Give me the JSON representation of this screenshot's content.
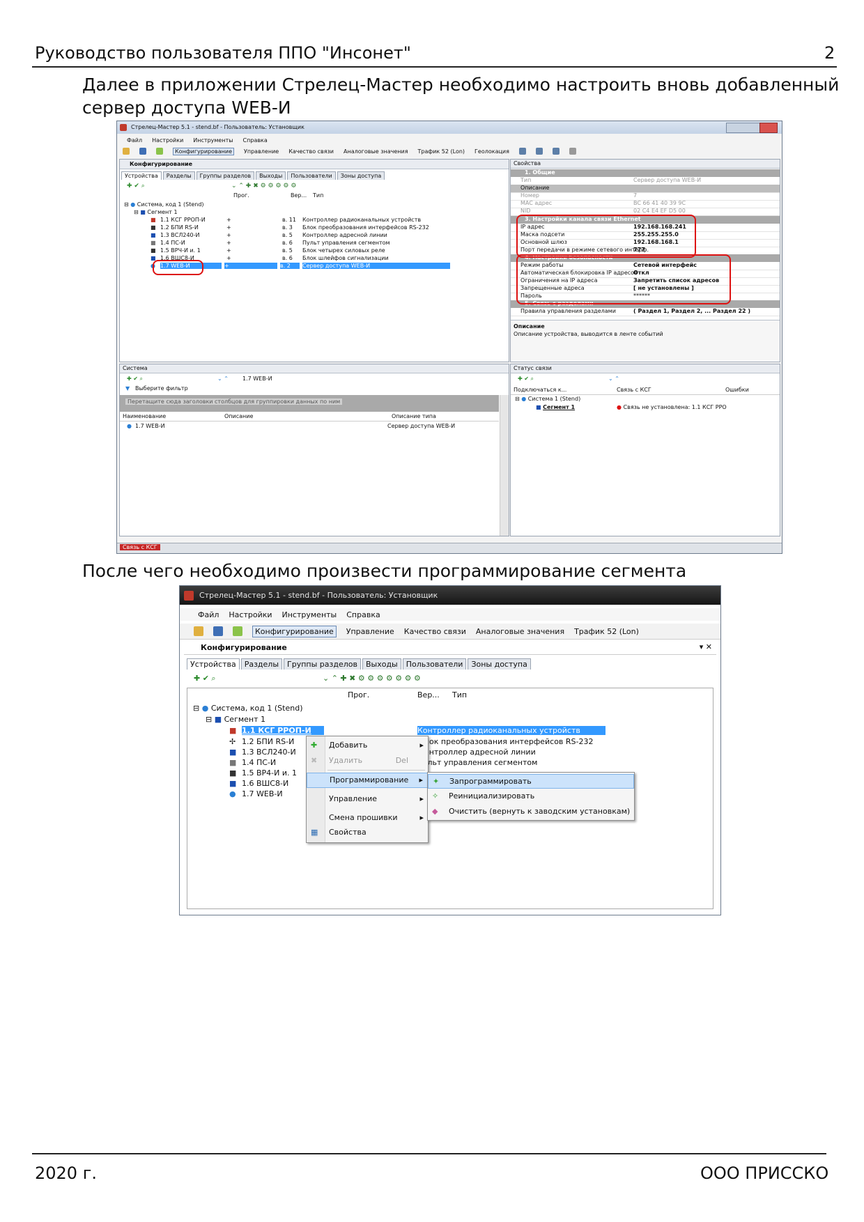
{
  "header": {
    "title": "Руководство пользователя ППО \"Инсонет\"",
    "page_number": "2"
  },
  "para1": {
    "line1": "Далее в приложении  Стрелец-Мастер необходимо настроить вновь добавленный",
    "line2": "сервер доступа WEB-И"
  },
  "para2": "После чего необходимо произвести программирование сегмента",
  "footer": {
    "year": "2020 г.",
    "company": "ООО ПРИССКО"
  },
  "shot1": {
    "title": "Стрелец-Мастер 5.1 - stend.bf - Пользователь: Установщик",
    "menu": [
      "Файл",
      "Настройки",
      "Инструменты",
      "Справка"
    ],
    "toolbar": [
      "Конфигурирование",
      "Управление",
      "Качество связи",
      "Аналоговые значения",
      "Трафик 52 (Lon)",
      "Геолокация"
    ],
    "config_panel_title": "Конфигурирование",
    "tabs": [
      "Устройства",
      "Разделы",
      "Группы разделов",
      "Выходы",
      "Пользователи",
      "Зоны доступа"
    ],
    "cols": [
      "Прог.",
      "Вер...",
      "Тип"
    ],
    "tree_root": "Система, код 1 (Stend)",
    "tree_segment": "Сегмент 1",
    "devices": [
      {
        "name": "1.1 КСГ РРОП-И",
        "prog": "+",
        "ver": "в. 11",
        "type": "Контроллер радиоканальных устройств"
      },
      {
        "name": "1.2 БПИ RS-И",
        "prog": "+",
        "ver": "в. 3",
        "type": "Блок преобразования интерфейсов RS-232"
      },
      {
        "name": "1.3 ВСЛ240-И",
        "prog": "+",
        "ver": "в. 5",
        "type": "Контроллер адресной линии"
      },
      {
        "name": "1.4 ПС-И",
        "prog": "+",
        "ver": "в. 6",
        "type": "Пульт управления сегментом"
      },
      {
        "name": "1.5 ВРЧ-И и. 1",
        "prog": "+",
        "ver": "в. 5",
        "type": "Блок четырех силовых реле"
      },
      {
        "name": "1.6 ВШС8-И",
        "prog": "+",
        "ver": "в. 6",
        "type": "Блок шлейфов сигнализации"
      },
      {
        "name": "1.7 WEB-И",
        "prog": "+",
        "ver": "в. 2",
        "type": "Сервер доступа WEB-И"
      }
    ],
    "props_title": "Свойства",
    "props": [
      {
        "group": "1. Общие",
        "rows": [
          [
            "Тип",
            "Сервер доступа WEB-И"
          ],
          [
            "Описание",
            ""
          ],
          [
            "Номер",
            "7"
          ],
          [
            "MAC адрес",
            "BC 66 41 40 39 9C"
          ],
          [
            "NID",
            "02 C4 E4 EF D5 00"
          ]
        ]
      },
      {
        "group": "3. Настройки канала связи Ethernet",
        "rows": [
          [
            "IP адрес",
            "192.168.168.241"
          ],
          [
            "Маска подсети",
            "255.255.255.0"
          ],
          [
            "Основной шлюз",
            "192.168.168.1"
          ],
          [
            "Порт передачи в режиме сетевого интерф.",
            "777"
          ]
        ]
      },
      {
        "group": "4. Настройки безопасности",
        "rows": [
          [
            "Режим работы",
            "Сетевой интерфейс"
          ],
          [
            "Автоматическая блокировка IP адресов",
            "Откл"
          ],
          [
            "Ограничения на IP адреса",
            "Запретить список адресов"
          ],
          [
            "Запрещенные адреса",
            "[ не установлены ]"
          ],
          [
            "Пароль",
            "******"
          ]
        ]
      },
      {
        "group": "5. Связь с разделами",
        "rows": [
          [
            "Правила управления разделами",
            "( Раздел 1, Раздел 2, ... Раздел 22 )"
          ]
        ]
      }
    ],
    "desc_title": "Описание",
    "desc_text": "Описание устройства, выводится в ленте событий",
    "system_panel": {
      "title": "Система",
      "filter": "Выберите фильтр",
      "path": "1.7 WEB-И",
      "group_hint": "Перетащите сюда заголовки столбцов для группировки данных по ним",
      "cols": [
        "Наименование",
        "Описание",
        "Описание типа"
      ],
      "row": {
        "name": "1.7 WEB-И",
        "desc": "",
        "type": "Сервер доступа WEB-И"
      }
    },
    "status_panel": {
      "title": "Статус связи",
      "cols": [
        "Подключаться к...",
        "Связь с КСГ",
        "Ошибки"
      ],
      "row_system": "Система 1 (Stend)",
      "row_segment": "Сегмент 1",
      "status": "Связь не установлена: 1.1 КСГ РРО"
    },
    "statusbar": "Связь с КСГ"
  },
  "shot2": {
    "title": "Стрелец-Мастер 5.1 - stend.bf - Пользователь: Установщик",
    "menu": [
      "Файл",
      "Настройки",
      "Инструменты",
      "Справка"
    ],
    "toolbar": [
      "Конфигурирование",
      "Управление",
      "Качество связи",
      "Аналоговые значения",
      "Трафик 52 (Lon)"
    ],
    "panel_title": "Конфигурирование",
    "tabs": [
      "Устройства",
      "Разделы",
      "Группы разделов",
      "Выходы",
      "Пользователи",
      "Зоны доступа"
    ],
    "cols": [
      "Прог.",
      "Вер...",
      "Тип"
    ],
    "tree_root": "Система, код 1 (Stend)",
    "tree_segment": "Сегмент 1",
    "devices": [
      "1.1 КСГ РРОП-И",
      "1.2 БПИ RS-И",
      "1.3 ВСЛ240-И",
      "1.4 ПС-И",
      "1.5 ВР4-И и. 1",
      "1.6 ВШС8-И",
      "1.7 WEB-И"
    ],
    "types_visible": [
      "Контроллер радиоканальных устройств",
      "лок преобразования интерфейсов RS-232",
      "онтроллер адресной линии",
      "ульт управления сегментом"
    ],
    "context_menu": [
      {
        "label": "Добавить",
        "shortcut": "",
        "arrow": "▸"
      },
      {
        "label": "Удалить",
        "shortcut": "Del",
        "arrow": ""
      },
      {
        "label": "Программирование",
        "shortcut": "",
        "arrow": "▸"
      },
      {
        "label": "Управление",
        "shortcut": "",
        "arrow": "▸"
      },
      {
        "label": "Смена прошивки",
        "shortcut": "",
        "arrow": "▸"
      },
      {
        "label": "Свойства",
        "shortcut": "",
        "arrow": ""
      }
    ],
    "submenu": [
      "Запрограммировать",
      "Реинициализировать",
      "Очистить (вернуть к заводским установкам)"
    ]
  }
}
